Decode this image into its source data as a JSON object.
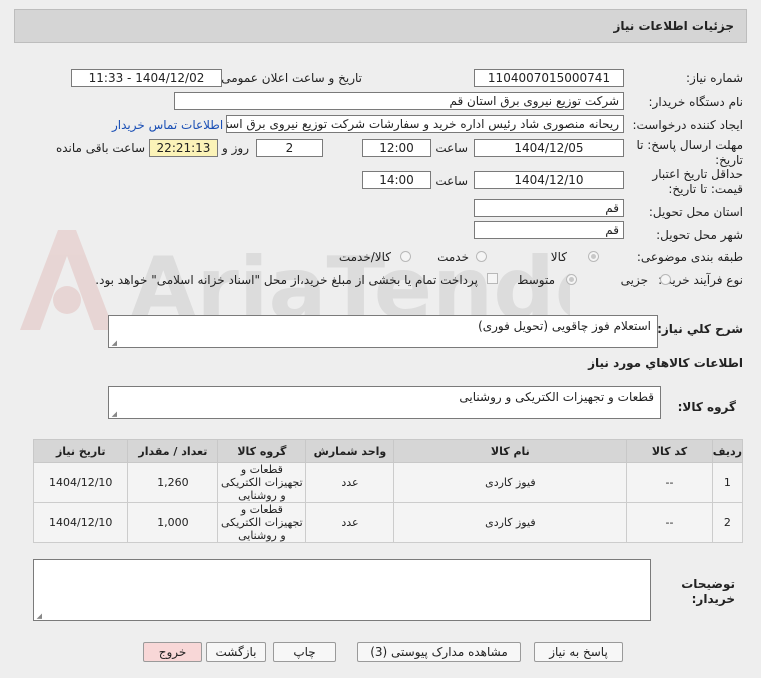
{
  "header": {
    "title": "جزئیات اطلاعات نیاز"
  },
  "fields": {
    "need_number_label": "شماره نیاز:",
    "need_number": "1104007015000741",
    "announce_label": "تاریخ و ساعت اعلان عمومی:",
    "announce_value": "1404/12/02 - 11:33",
    "buyer_label": "نام دستگاه خریدار:",
    "buyer_value": "شرکت توزیع نیروی برق استان قم",
    "creator_label": "ایجاد کننده درخواست:",
    "creator_value": "ریحانه منصوری شاد رئیس اداره خرید و سفارشات شرکت توزیع نیروی برق استان",
    "contact_link": "اطلاعات تماس خریدار",
    "deadline_label_1": "مهلت ارسال پاسخ: تا",
    "deadline_label_2": "تاریخ:",
    "deadline_date": "1404/12/05",
    "time_label": "ساعت",
    "deadline_time": "12:00",
    "days_value": "2",
    "days_label": "روز و",
    "remaining_value": "22:21:13",
    "remaining_label": "ساعت باقی مانده",
    "validity_label_1": "حداقل تاریخ اعتبار",
    "validity_label_2": "قیمت: تا تاریخ:",
    "validity_date": "1404/12/10",
    "validity_time_label": "ساعت",
    "validity_time": "14:00",
    "province_label": "استان محل تحویل:",
    "province_value": "قم",
    "city_label": "شهر محل تحویل:",
    "city_value": "قم",
    "category_label": "طبقه بندی موضوعی:",
    "category_options": [
      "کالا",
      "خدمت",
      "کالا/خدمت"
    ],
    "process_label": "نوع فرآیند خرید :",
    "process_options": [
      "جزیی",
      "متوسط"
    ],
    "payment_note": "پرداخت تمام یا بخشی از مبلغ خرید،از محل \"اسناد خزانه اسلامی\" خواهد بود.",
    "description_label": "شرح کلي نياز:",
    "description_value": "استعلام فوز چاقویی (تحویل فوری)",
    "goods_info_title": "اطلاعات کالاهاي مورد نياز",
    "goods_group_label": "گروه کالا:",
    "goods_group_value": "قطعات و تجهیزات الکتریکی و روشنایی",
    "buyer_notes_label_1": "توضيحات",
    "buyer_notes_label_2": "خريدار:"
  },
  "watermark": {
    "text": "AriaTender.neT"
  },
  "table": {
    "headers": [
      "ردیف",
      "کد کالا",
      "نام کالا",
      "واحد شمارش",
      "گروه کالا",
      "تعداد / مقدار",
      "تاریخ نیاز"
    ],
    "rows": [
      {
        "row": "1",
        "code": "--",
        "name": "فیوز کاردی",
        "unit": "عدد",
        "group": "قطعات و تجهیزات الکتریکی و روشنایی",
        "qty": "1,260",
        "date": "1404/12/10"
      },
      {
        "row": "2",
        "code": "--",
        "name": "فیوز کاردی",
        "unit": "عدد",
        "group": "قطعات و تجهیزات الکتریکی و روشنایی",
        "qty": "1,000",
        "date": "1404/12/10"
      }
    ]
  },
  "buttons": {
    "reply": "پاسخ به نیاز",
    "attachments": "مشاهده مدارک پیوستی (3)",
    "print": "چاپ",
    "back": "بازگشت",
    "exit": "خروج"
  },
  "colors": {
    "link": "#1a4fb5",
    "remaining_bg": "#fbf3b8",
    "exit_bg": "#f8d7d7"
  }
}
